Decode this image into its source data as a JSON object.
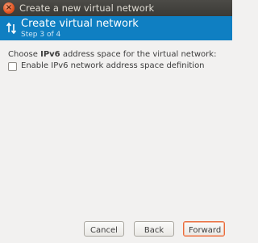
{
  "window": {
    "title": "Create a new virtual network"
  },
  "header": {
    "title": "Create virtual network",
    "step": "Step 3 of 4",
    "icon": "network-arrows-icon",
    "background": "#0f7fc2"
  },
  "content": {
    "prompt_before": "Choose ",
    "prompt_bold": "IPv6",
    "prompt_after": " address space for the virtual network:",
    "checkbox_label": "Enable IPv6 network address space definition",
    "checkbox_checked": false
  },
  "buttons": {
    "cancel": "Cancel",
    "back": "Back",
    "forward": "Forward"
  },
  "colors": {
    "accent": "#0f7fc2",
    "default_button_border": "#e96c3c",
    "close_button": "#e2531f"
  }
}
